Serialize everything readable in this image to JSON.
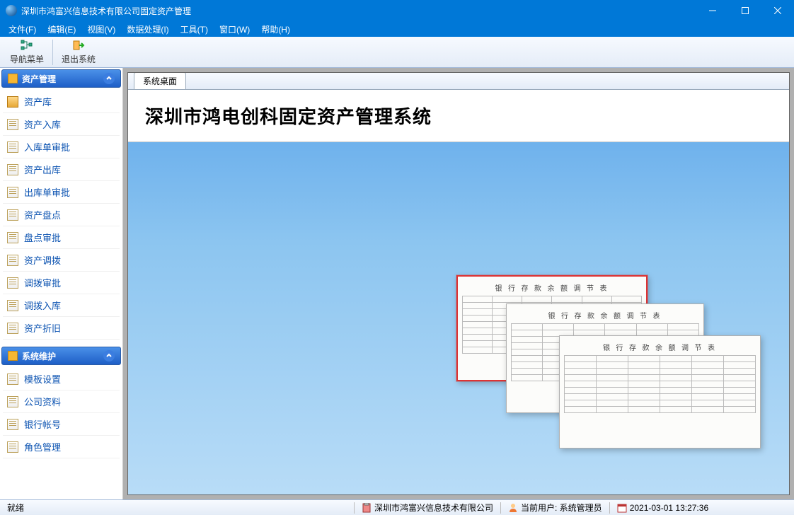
{
  "title": "深圳市鸿富兴信息技术有限公司固定资产管理",
  "menus": {
    "file": "文件(F)",
    "edit": "编辑(E)",
    "view": "视图(V)",
    "data": "数据处理(I)",
    "tool": "工具(T)",
    "window": "窗口(W)",
    "help": "帮助(H)"
  },
  "toolbar": {
    "nav": "导航菜单",
    "exit": "退出系统"
  },
  "sidebar": {
    "group1_title": "资产管理",
    "group1_items": [
      "资产库",
      "资产入库",
      "入库单审批",
      "资产出库",
      "出库单审批",
      "资产盘点",
      "盘点审批",
      "资产调拨",
      "调拨审批",
      "调拨入库",
      "资产折旧"
    ],
    "group2_title": "系统维护",
    "group2_items": [
      "模板设置",
      "公司资料",
      "银行帐号",
      "角色管理"
    ]
  },
  "desktop": {
    "tab": "系统桌面",
    "banner": "深圳市鸿电创科固定资产管理系统",
    "form_title": "银 行 存 款 余 额 调 节 表"
  },
  "status": {
    "ready": "就绪",
    "company": "深圳市鸿富兴信息技术有限公司",
    "user_label": "当前用户: 系统管理员",
    "datetime": "2021-03-01 13:27:36"
  }
}
